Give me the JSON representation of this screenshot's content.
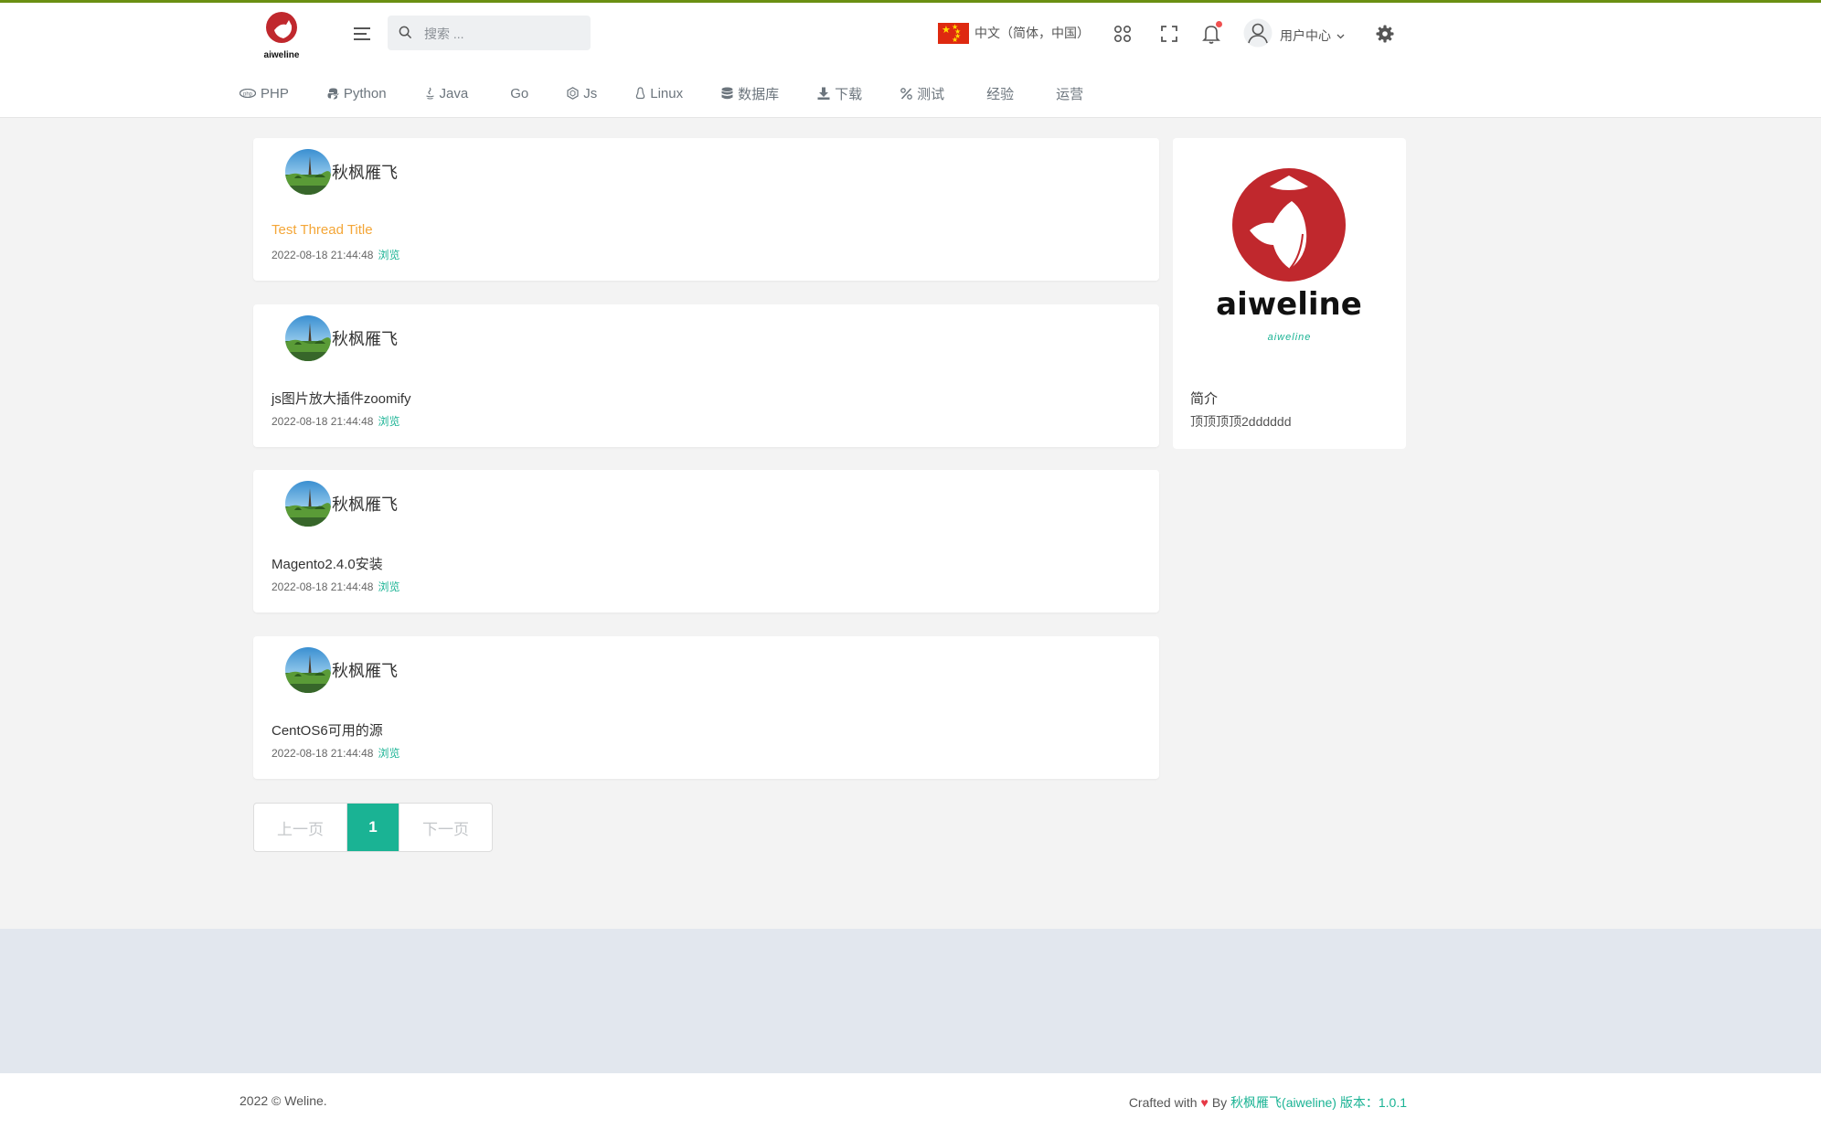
{
  "header": {
    "logo_text": "aiweline",
    "search_placeholder": "搜索 ...",
    "language": "中文（简体，中国）",
    "user_menu": "用户中心"
  },
  "nav": {
    "items": [
      {
        "label": "PHP",
        "icon": "php-icon"
      },
      {
        "label": "Python",
        "icon": "python-icon"
      },
      {
        "label": "Java",
        "icon": "java-icon"
      },
      {
        "label": "Go",
        "icon": ""
      },
      {
        "label": "Js",
        "icon": "js-icon"
      },
      {
        "label": "Linux",
        "icon": "linux-icon"
      },
      {
        "label": "数据库",
        "icon": "database-icon"
      },
      {
        "label": "下载",
        "icon": "download-icon"
      },
      {
        "label": "测试",
        "icon": "percent-icon"
      },
      {
        "label": "经验",
        "icon": ""
      },
      {
        "label": "运营",
        "icon": ""
      }
    ]
  },
  "posts": [
    {
      "author": "秋枫雁飞",
      "title": "Test Thread Title",
      "date": "2022-08-18 21:44:48",
      "view_label": "浏览"
    },
    {
      "author": "秋枫雁飞",
      "title": "js图片放大插件zoomify",
      "date": "2022-08-18 21:44:48",
      "view_label": "浏览"
    },
    {
      "author": "秋枫雁飞",
      "title": "Magento2.4.0安装",
      "date": "2022-08-18 21:44:48",
      "view_label": "浏览"
    },
    {
      "author": "秋枫雁飞",
      "title": "CentOS6可用的源",
      "date": "2022-08-18 21:44:48",
      "view_label": "浏览"
    }
  ],
  "sidebar": {
    "brand": "aiweline",
    "brand_sub": "aiweline",
    "intro_label": "简介",
    "intro_text": "顶顶顶顶2dddddd"
  },
  "pagination": {
    "prev": "上一页",
    "current": "1",
    "next": "下一页"
  },
  "footer": {
    "copyright": "2022 © Weline.",
    "crafted": "Crafted with",
    "heart": "♥",
    "by": "By",
    "author_link": "秋枫雁飞(aiweline) 版本：1.0.1"
  },
  "colors": {
    "accent": "#1ab394",
    "highlight_title": "#f4a637",
    "brand_red": "#c0282d",
    "top_line": "#6a8f12"
  }
}
